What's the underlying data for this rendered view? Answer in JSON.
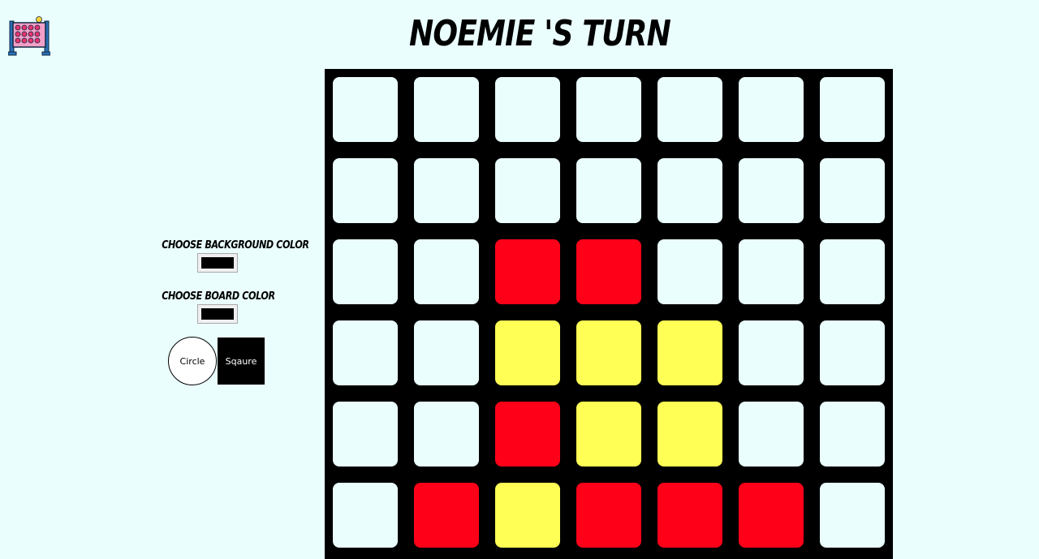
{
  "header": {
    "title": "NOEMIE 'S TURN",
    "logo_icon": "connect-four-icon"
  },
  "controls": {
    "background_color_label": "CHOOSE BACKGROUND COLOR",
    "background_color_value": "#000000",
    "board_color_label": "CHOOSE BOARD COLOR",
    "board_color_value": "#000000",
    "circle_button_label": "Circle",
    "square_button_label": "Sqaure"
  },
  "colors": {
    "page_background": "#eafefe",
    "board": "#000000",
    "empty": "#eafefe",
    "red": "#ff0019",
    "yellow": "#ffff55"
  },
  "board": {
    "rows": 6,
    "cols": 7,
    "cells": [
      [
        "empty",
        "empty",
        "empty",
        "empty",
        "empty",
        "empty",
        "empty"
      ],
      [
        "empty",
        "empty",
        "empty",
        "empty",
        "empty",
        "empty",
        "empty"
      ],
      [
        "empty",
        "empty",
        "red",
        "red",
        "empty",
        "empty",
        "empty"
      ],
      [
        "empty",
        "empty",
        "yellow",
        "yellow",
        "yellow",
        "empty",
        "empty"
      ],
      [
        "empty",
        "empty",
        "red",
        "yellow",
        "yellow",
        "empty",
        "empty"
      ],
      [
        "empty",
        "red",
        "yellow",
        "red",
        "red",
        "red",
        "empty"
      ]
    ]
  }
}
